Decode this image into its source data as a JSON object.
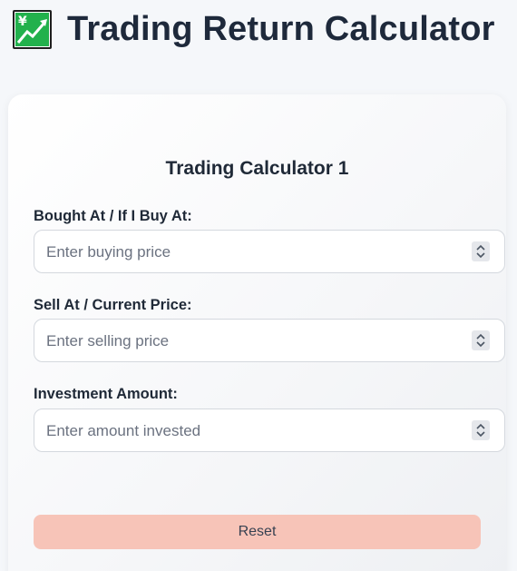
{
  "header": {
    "icon": "chart-increasing-with-yen-icon",
    "title": "Trading Return Calculator"
  },
  "calculator": {
    "title": "Trading Calculator 1",
    "fields": [
      {
        "label": "Bought At / If I Buy At:",
        "placeholder": "Enter buying price",
        "value": ""
      },
      {
        "label": "Sell At / Current Price:",
        "placeholder": "Enter selling price",
        "value": ""
      },
      {
        "label": "Investment Amount:",
        "placeholder": "Enter amount invested",
        "value": ""
      }
    ],
    "reset_label": "Reset"
  },
  "colors": {
    "reset_button": "#f7c4b8",
    "icon_green": "#22b14c"
  }
}
